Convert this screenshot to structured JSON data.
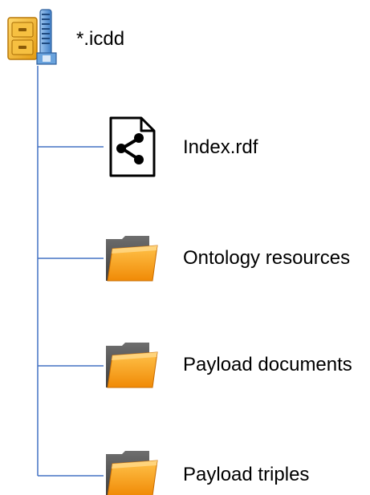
{
  "root": {
    "label": "*.icdd",
    "icon": "zip-archive-icon"
  },
  "children": [
    {
      "label": "Index.rdf",
      "icon": "rdf-file-icon"
    },
    {
      "label": "Ontology resources",
      "icon": "folder-icon"
    },
    {
      "label": "Payload documents",
      "icon": "folder-icon"
    },
    {
      "label": "Payload triples",
      "icon": "folder-icon"
    }
  ],
  "colors": {
    "connector": "#4472c4",
    "folder_orange": "#f7a51c",
    "folder_dark": "#5a5a5a"
  }
}
